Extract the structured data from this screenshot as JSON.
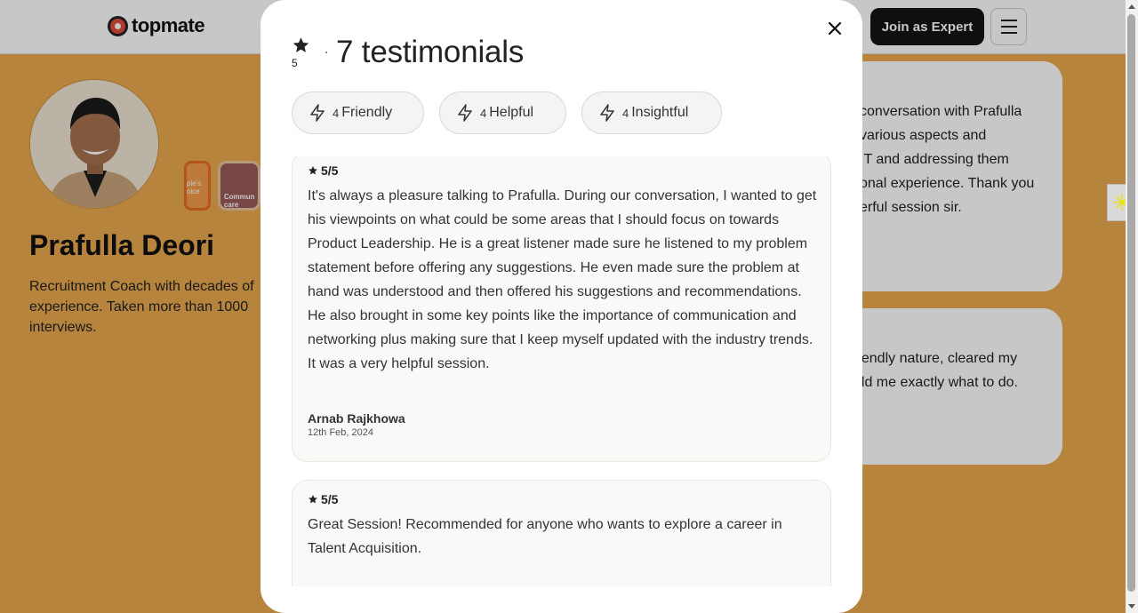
{
  "brand": {
    "name": "topmate"
  },
  "nav": {
    "join_label": "Join as Expert",
    "menu_icon": "hamburger-menu-icon"
  },
  "profile": {
    "name": "Prafulla Deori",
    "bio": "Recruitment Coach with decades of\nexperience. Taken more than 1000\ninterviews.",
    "badges": [
      {
        "label": "ple's\noice"
      },
      {
        "label": "Commun\ncare"
      }
    ]
  },
  "background_reviews": [
    {
      "text": "conversation with Prafulla\nvarious aspects and\nIT and addressing them\nonal experience. Thank you\nerful session sir."
    },
    {
      "text": "riendly nature, cleared my\nold me exactly what to do."
    }
  ],
  "modal": {
    "rating": "5",
    "title": "7 testimonials",
    "close_icon": "close-icon",
    "chips": [
      {
        "count": "4",
        "label": "Friendly"
      },
      {
        "count": "4",
        "label": "Helpful"
      },
      {
        "count": "4",
        "label": "Insightful"
      }
    ],
    "reviews": [
      {
        "rating": "5/5",
        "text": "It's always a pleasure talking to Prafulla. During our conversation, I wanted to get his viewpoints on what could be some areas that I should focus on towards Product Leadership. He is a great listener made sure he listened to my problem statement before offering any suggestions. He even made sure the problem at hand was understood and then offered his suggestions and recommendations. He also brought in some key points like the importance of communication and networking plus making sure that I keep myself updated with the industry trends. It was a very helpful session.",
        "author": "Arnab Rajkhowa",
        "date": "12th Feb, 2024"
      },
      {
        "rating": "5/5",
        "text": "Great Session! Recommended for anyone who wants to explore a career in Talent Acquisition."
      }
    ]
  },
  "colors": {
    "page_bg": "#e9a94e",
    "brand_red": "#e4493b",
    "button_dark": "#141414"
  }
}
